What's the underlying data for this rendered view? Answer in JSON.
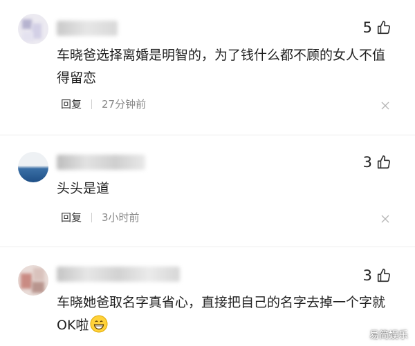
{
  "comments": [
    {
      "likes": "5",
      "text": "车晓爸选择离婚是明智的，为了钱什么都不顾的女人不值得留恋",
      "reply_label": "回复",
      "time": "27分钟前"
    },
    {
      "likes": "3",
      "text": "头头是道",
      "reply_label": "回复",
      "time": "3小时前"
    },
    {
      "likes": "3",
      "text": "车晓她爸取名字真省心，直接把自己的名字去掉一个字就OK啦",
      "emoji": "grinning-face-icon"
    }
  ],
  "watermark": {
    "text": "易简娱乐"
  },
  "colors": {
    "text": "#1f1f1f",
    "muted": "#888888",
    "divider": "#ececec"
  }
}
